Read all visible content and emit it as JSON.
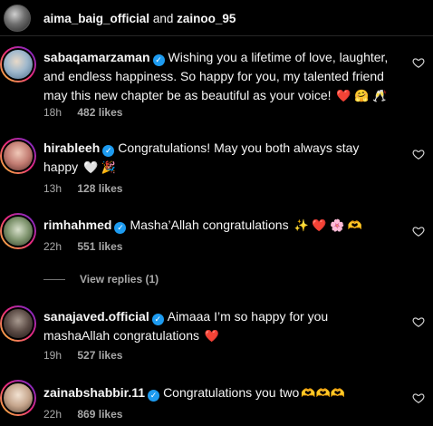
{
  "header": {
    "user1": "aima_baig_official",
    "joiner": "and",
    "user2": "zainoo_95"
  },
  "comments": [
    {
      "username": "sabaqamarzaman",
      "text": "Wishing you a lifetime of love, laughter, and endless happiness. So happy for you, my talented friend may this new chapter be as beautiful as your voice!",
      "emojis": "❤️ 🤗 🥂",
      "time": "18h",
      "likes": "482 likes",
      "avatar_color": "#b7c9d9"
    },
    {
      "username": "hirableeh",
      "text": "Congratulations! May you both always stay happy",
      "emojis": "🤍 🎉",
      "time": "13h",
      "likes": "128 likes",
      "avatar_color": "#c98f8a"
    },
    {
      "username": "rimhahmed",
      "text": "Masha’Allah congratulations",
      "emojis": "✨ ❤️ 🌸 🫶",
      "time": "22h",
      "likes": "551 likes",
      "avatar_color": "#8a9a7a"
    },
    {
      "username": "sanajaved.official",
      "text": "Aimaaa I’m so happy for you mashaAllah congratulations",
      "emojis": "❤️",
      "time": "19h",
      "likes": "527 likes",
      "avatar_color": "#5a4a44"
    },
    {
      "username": "zainabshabbir.11",
      "text": "Congratulations you two",
      "emojis": "🫶🫶🫶",
      "time": "22h",
      "likes": "869 likes",
      "avatar_color": "#c5a58c"
    }
  ],
  "view_replies": "View replies (1)",
  "colors": {
    "background": "#000000",
    "verified": "#1d9bf0",
    "heart_emoji": "#e0245e",
    "muted": "#a8a8a8"
  }
}
